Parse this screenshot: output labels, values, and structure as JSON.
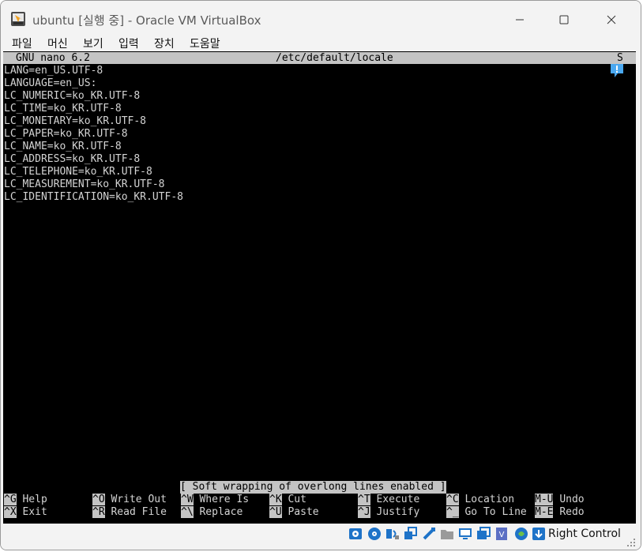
{
  "window": {
    "title": "ubuntu [실행 중] - Oracle VM VirtualBox",
    "controls": {
      "minimize": "—",
      "maximize": "☐",
      "close": "✕"
    }
  },
  "menu": [
    "파일",
    "머신",
    "보기",
    "입력",
    "장치",
    "도움말"
  ],
  "nano": {
    "header": {
      "version": "GNU nano 6.2",
      "filename": "/etc/default/locale",
      "flag": "S"
    },
    "lines": [
      "LANG=en_US.UTF-8",
      "LANGUAGE=en_US:",
      "LC_NUMERIC=ko_KR.UTF-8",
      "LC_TIME=ko_KR.UTF-8",
      "LC_MONETARY=ko_KR.UTF-8",
      "LC_PAPER=ko_KR.UTF-8",
      "LC_NAME=ko_KR.UTF-8",
      "LC_ADDRESS=ko_KR.UTF-8",
      "LC_TELEPHONE=ko_KR.UTF-8",
      "LC_MEASUREMENT=ko_KR.UTF-8",
      "LC_IDENTIFICATION=ko_KR.UTF-8"
    ],
    "status_message": "[ Soft wrapping of overlong lines enabled ]",
    "shortcuts": [
      [
        {
          "key": "^G",
          "label": "Help"
        },
        {
          "key": "^O",
          "label": "Write Out"
        },
        {
          "key": "^W",
          "label": "Where Is"
        },
        {
          "key": "^K",
          "label": "Cut"
        },
        {
          "key": "^T",
          "label": "Execute"
        },
        {
          "key": "^C",
          "label": "Location"
        },
        {
          "key": "M-U",
          "label": "Undo"
        }
      ],
      [
        {
          "key": "^X",
          "label": "Exit"
        },
        {
          "key": "^R",
          "label": "Read File"
        },
        {
          "key": "^\\",
          "label": "Replace"
        },
        {
          "key": "^U",
          "label": "Paste"
        },
        {
          "key": "^J",
          "label": "Justify"
        },
        {
          "key": "^_",
          "label": "Go To Line"
        },
        {
          "key": "M-E",
          "label": "Redo"
        }
      ]
    ]
  },
  "statusbar": {
    "icons": [
      "hard-disk-icon",
      "optical-drive-icon",
      "audio-icon",
      "network-icon",
      "usb-icon",
      "shared-folders-icon",
      "display-icon",
      "video-capture-icon",
      "virtualization-icon",
      "mouse-integration-icon",
      "keyboard-capture-icon"
    ],
    "host_key": "Right Control"
  },
  "colors": {
    "terminal_bg": "#000000",
    "terminal_fg": "#d4d4d4",
    "inverse_bg": "#c4c4c4",
    "accent": "#1e73c8"
  }
}
